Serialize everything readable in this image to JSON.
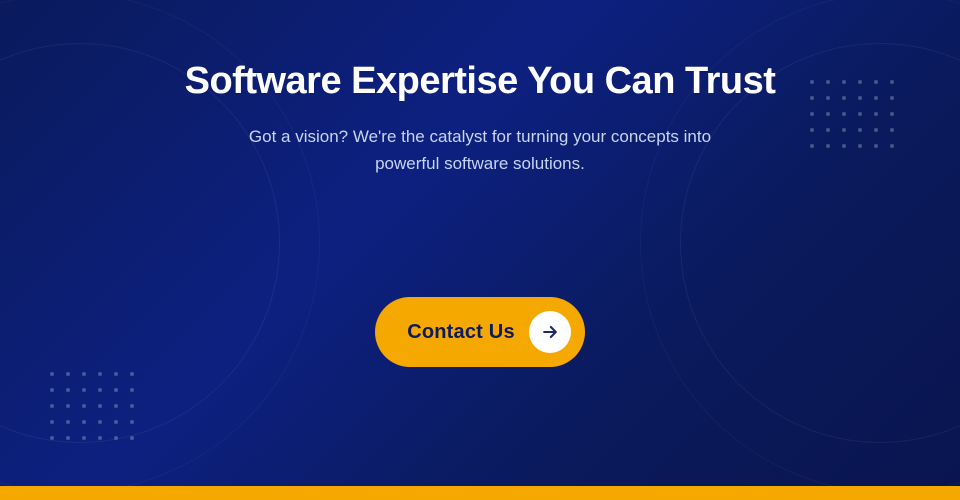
{
  "hero": {
    "heading": "Software Expertise You Can Trust",
    "subheading_line1": "Got a vision? We're the catalyst for turning your concepts into",
    "subheading_line2": "powerful software solutions.",
    "subheading": "Got a vision? We're the catalyst for turning your concepts into\npowerful software solutions.",
    "cta_label": "Contact Us",
    "arrow_icon": "arrow-right-icon"
  },
  "colors": {
    "background_start": "#0a1a5c",
    "background_end": "#091550",
    "accent": "#f5a800",
    "text_primary": "#ffffff",
    "text_secondary": "#c8d4f0",
    "bottom_bar": "#f5a800"
  }
}
